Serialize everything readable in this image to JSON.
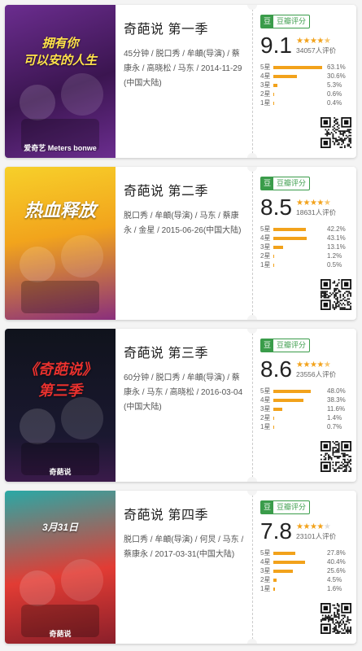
{
  "colors": {
    "accent": "#3a9c4a",
    "star": "#f2a21b",
    "bar": "#f2a21b"
  },
  "cards": [
    {
      "title": "奇葩说 第一季",
      "meta": "45分钟 / 脱口秀 / 牟頔(导演) / 蔡康永 / 高晓松 / 马东 / 2014-11-29(中国大陆)",
      "badge_icon": "豆",
      "badge_text": "豆瓣评分",
      "score": "9.1",
      "stars": 4.5,
      "votes": "34057人评价",
      "bars": [
        {
          "label": "5星",
          "pct": "63.1%",
          "value": 63.1
        },
        {
          "label": "4星",
          "pct": "30.6%",
          "value": 30.6
        },
        {
          "label": "3星",
          "pct": "5.3%",
          "value": 5.3
        },
        {
          "label": "2星",
          "pct": "0.6%",
          "value": 0.6
        },
        {
          "label": "1星",
          "pct": "0.4%",
          "value": 0.4
        }
      ],
      "poster_text": "拥有你\n可以安的人生",
      "poster_bottom": "爱奇艺   Meters bonwe"
    },
    {
      "title": "奇葩说 第二季",
      "meta": "脱口秀 / 牟頔(导演) / 马东 / 蔡康永 / 金星 / 2015-06-26(中国大陆)",
      "badge_icon": "豆",
      "badge_text": "豆瓣评分",
      "score": "8.5",
      "stars": 4.5,
      "votes": "18631人评价",
      "bars": [
        {
          "label": "5星",
          "pct": "42.2%",
          "value": 42.2
        },
        {
          "label": "4星",
          "pct": "43.1%",
          "value": 43.1
        },
        {
          "label": "3星",
          "pct": "13.1%",
          "value": 13.1
        },
        {
          "label": "2星",
          "pct": "1.2%",
          "value": 1.2
        },
        {
          "label": "1星",
          "pct": "0.5%",
          "value": 0.5
        }
      ],
      "poster_text": "热血释放",
      "poster_bottom": ""
    },
    {
      "title": "奇葩说 第三季",
      "meta": "60分钟 / 脱口秀 / 牟頔(导演) / 蔡康永 / 马东 / 高晓松 / 2016-03-04(中国大陆)",
      "badge_icon": "豆",
      "badge_text": "豆瓣评分",
      "score": "8.6",
      "stars": 4.5,
      "votes": "23556人评价",
      "bars": [
        {
          "label": "5星",
          "pct": "48.0%",
          "value": 48.0
        },
        {
          "label": "4星",
          "pct": "38.3%",
          "value": 38.3
        },
        {
          "label": "3星",
          "pct": "11.6%",
          "value": 11.6
        },
        {
          "label": "2星",
          "pct": "1.4%",
          "value": 1.4
        },
        {
          "label": "1星",
          "pct": "0.7%",
          "value": 0.7
        }
      ],
      "poster_text": "《奇葩说》\n第三季",
      "poster_bottom": "奇葩说"
    },
    {
      "title": "奇葩说 第四季",
      "meta": "脱口秀 / 牟頔(导演) / 何炅 / 马东 / 蔡康永 / 2017-03-31(中国大陆)",
      "badge_icon": "豆",
      "badge_text": "豆瓣评分",
      "score": "7.8",
      "stars": 4,
      "votes": "23101人评价",
      "bars": [
        {
          "label": "5星",
          "pct": "27.8%",
          "value": 27.8
        },
        {
          "label": "4星",
          "pct": "40.4%",
          "value": 40.4
        },
        {
          "label": "3星",
          "pct": "25.6%",
          "value": 25.6
        },
        {
          "label": "2星",
          "pct": "4.5%",
          "value": 4.5
        },
        {
          "label": "1星",
          "pct": "1.6%",
          "value": 1.6
        }
      ],
      "poster_text": "3月31日",
      "poster_bottom": "奇葩说"
    }
  ]
}
